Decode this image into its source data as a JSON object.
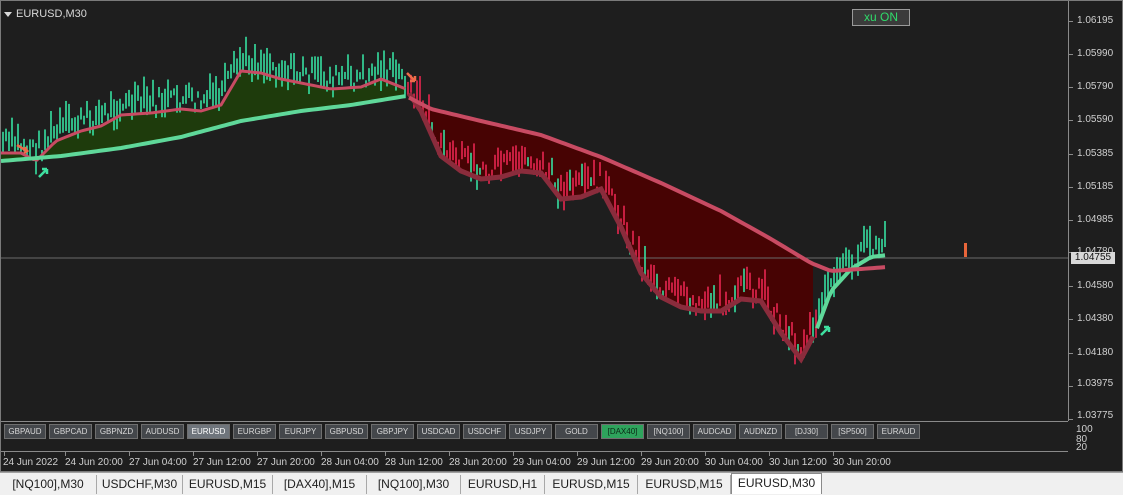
{
  "chart": {
    "title": "EURUSD,M30",
    "indicator_badge": "xu ON",
    "current_price": "1.04755",
    "price_labels": [
      "1.06195",
      "1.05990",
      "1.05790",
      "1.05590",
      "1.05385",
      "1.05185",
      "1.04985",
      "1.04780",
      "1.04580",
      "1.04380",
      "1.04180",
      "1.03975",
      "1.03775"
    ],
    "subpanel_labels": [
      "100",
      "80",
      "20"
    ],
    "time_labels": [
      "24 Jun 2022",
      "24 Jun 20:00",
      "27 Jun 04:00",
      "27 Jun 12:00",
      "27 Jun 20:00",
      "28 Jun 04:00",
      "28 Jun 12:00",
      "28 Jun 20:00",
      "29 Jun 04:00",
      "29 Jun 12:00",
      "29 Jun 20:00",
      "30 Jun 04:00",
      "30 Jun 12:00",
      "30 Jun 20:00"
    ],
    "colors": {
      "bull_candle": "#36e0a0",
      "bear_candle": "#e8264f",
      "fast_ma": "#5fd89a",
      "slow_ma": "#c84b63",
      "fill_up": "#1f3d0c",
      "fill_down": "#4a0202"
    }
  },
  "symbol_buttons": [
    {
      "label": "GBPAUD",
      "state": "normal"
    },
    {
      "label": "GBPCAD",
      "state": "normal"
    },
    {
      "label": "GBPNZD",
      "state": "normal"
    },
    {
      "label": "AUDUSD",
      "state": "normal"
    },
    {
      "label": "EURUSD",
      "state": "active"
    },
    {
      "label": "EURGBP",
      "state": "normal"
    },
    {
      "label": "EURJPY",
      "state": "normal"
    },
    {
      "label": "GBPUSD",
      "state": "normal"
    },
    {
      "label": "GBPJPY",
      "state": "normal"
    },
    {
      "label": "USDCAD",
      "state": "normal"
    },
    {
      "label": "USDCHF",
      "state": "normal"
    },
    {
      "label": "USDJPY",
      "state": "normal"
    },
    {
      "label": "GOLD",
      "state": "normal"
    },
    {
      "label": "[DAX40]",
      "state": "green"
    },
    {
      "label": "[NQ100]",
      "state": "normal"
    },
    {
      "label": "AUDCAD",
      "state": "normal"
    },
    {
      "label": "AUDNZD",
      "state": "normal"
    },
    {
      "label": "[DJ30]",
      "state": "normal"
    },
    {
      "label": "[SP500]",
      "state": "normal"
    },
    {
      "label": "EURAUD",
      "state": "normal"
    }
  ],
  "tabs": [
    {
      "label": "[NQ100],M30",
      "active": false
    },
    {
      "label": "USDCHF,M30",
      "active": false
    },
    {
      "label": "EURUSD,M15",
      "active": false
    },
    {
      "label": "[DAX40],M15",
      "active": false
    },
    {
      "label": "[NQ100],M30",
      "active": false
    },
    {
      "label": "EURUSD,H1",
      "active": false
    },
    {
      "label": "EURUSD,M15",
      "active": false
    },
    {
      "label": "EURUSD,M15",
      "active": false
    },
    {
      "label": "EURUSD,M30",
      "active": true
    }
  ]
}
